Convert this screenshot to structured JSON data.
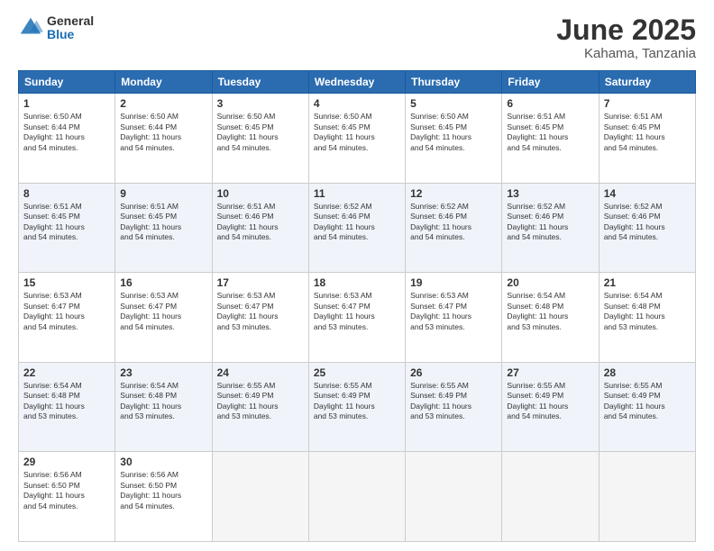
{
  "logo": {
    "general": "General",
    "blue": "Blue"
  },
  "header": {
    "month": "June 2025",
    "location": "Kahama, Tanzania"
  },
  "days_of_week": [
    "Sunday",
    "Monday",
    "Tuesday",
    "Wednesday",
    "Thursday",
    "Friday",
    "Saturday"
  ],
  "weeks": [
    {
      "cells": [
        {
          "day": "1",
          "sunrise": "6:50 AM",
          "sunset": "6:44 PM",
          "daylight": "11 hours and 54 minutes."
        },
        {
          "day": "2",
          "sunrise": "6:50 AM",
          "sunset": "6:44 PM",
          "daylight": "11 hours and 54 minutes."
        },
        {
          "day": "3",
          "sunrise": "6:50 AM",
          "sunset": "6:45 PM",
          "daylight": "11 hours and 54 minutes."
        },
        {
          "day": "4",
          "sunrise": "6:50 AM",
          "sunset": "6:45 PM",
          "daylight": "11 hours and 54 minutes."
        },
        {
          "day": "5",
          "sunrise": "6:50 AM",
          "sunset": "6:45 PM",
          "daylight": "11 hours and 54 minutes."
        },
        {
          "day": "6",
          "sunrise": "6:51 AM",
          "sunset": "6:45 PM",
          "daylight": "11 hours and 54 minutes."
        },
        {
          "day": "7",
          "sunrise": "6:51 AM",
          "sunset": "6:45 PM",
          "daylight": "11 hours and 54 minutes."
        }
      ]
    },
    {
      "cells": [
        {
          "day": "8",
          "sunrise": "6:51 AM",
          "sunset": "6:45 PM",
          "daylight": "11 hours and 54 minutes."
        },
        {
          "day": "9",
          "sunrise": "6:51 AM",
          "sunset": "6:45 PM",
          "daylight": "11 hours and 54 minutes."
        },
        {
          "day": "10",
          "sunrise": "6:51 AM",
          "sunset": "6:46 PM",
          "daylight": "11 hours and 54 minutes."
        },
        {
          "day": "11",
          "sunrise": "6:52 AM",
          "sunset": "6:46 PM",
          "daylight": "11 hours and 54 minutes."
        },
        {
          "day": "12",
          "sunrise": "6:52 AM",
          "sunset": "6:46 PM",
          "daylight": "11 hours and 54 minutes."
        },
        {
          "day": "13",
          "sunrise": "6:52 AM",
          "sunset": "6:46 PM",
          "daylight": "11 hours and 54 minutes."
        },
        {
          "day": "14",
          "sunrise": "6:52 AM",
          "sunset": "6:46 PM",
          "daylight": "11 hours and 54 minutes."
        }
      ]
    },
    {
      "cells": [
        {
          "day": "15",
          "sunrise": "6:53 AM",
          "sunset": "6:47 PM",
          "daylight": "11 hours and 54 minutes."
        },
        {
          "day": "16",
          "sunrise": "6:53 AM",
          "sunset": "6:47 PM",
          "daylight": "11 hours and 54 minutes."
        },
        {
          "day": "17",
          "sunrise": "6:53 AM",
          "sunset": "6:47 PM",
          "daylight": "11 hours and 53 minutes."
        },
        {
          "day": "18",
          "sunrise": "6:53 AM",
          "sunset": "6:47 PM",
          "daylight": "11 hours and 53 minutes."
        },
        {
          "day": "19",
          "sunrise": "6:53 AM",
          "sunset": "6:47 PM",
          "daylight": "11 hours and 53 minutes."
        },
        {
          "day": "20",
          "sunrise": "6:54 AM",
          "sunset": "6:48 PM",
          "daylight": "11 hours and 53 minutes."
        },
        {
          "day": "21",
          "sunrise": "6:54 AM",
          "sunset": "6:48 PM",
          "daylight": "11 hours and 53 minutes."
        }
      ]
    },
    {
      "cells": [
        {
          "day": "22",
          "sunrise": "6:54 AM",
          "sunset": "6:48 PM",
          "daylight": "11 hours and 53 minutes."
        },
        {
          "day": "23",
          "sunrise": "6:54 AM",
          "sunset": "6:48 PM",
          "daylight": "11 hours and 53 minutes."
        },
        {
          "day": "24",
          "sunrise": "6:55 AM",
          "sunset": "6:49 PM",
          "daylight": "11 hours and 53 minutes."
        },
        {
          "day": "25",
          "sunrise": "6:55 AM",
          "sunset": "6:49 PM",
          "daylight": "11 hours and 53 minutes."
        },
        {
          "day": "26",
          "sunrise": "6:55 AM",
          "sunset": "6:49 PM",
          "daylight": "11 hours and 53 minutes."
        },
        {
          "day": "27",
          "sunrise": "6:55 AM",
          "sunset": "6:49 PM",
          "daylight": "11 hours and 54 minutes."
        },
        {
          "day": "28",
          "sunrise": "6:55 AM",
          "sunset": "6:49 PM",
          "daylight": "11 hours and 54 minutes."
        }
      ]
    },
    {
      "cells": [
        {
          "day": "29",
          "sunrise": "6:56 AM",
          "sunset": "6:50 PM",
          "daylight": "11 hours and 54 minutes."
        },
        {
          "day": "30",
          "sunrise": "6:56 AM",
          "sunset": "6:50 PM",
          "daylight": "11 hours and 54 minutes."
        },
        null,
        null,
        null,
        null,
        null
      ]
    }
  ],
  "labels": {
    "sunrise": "Sunrise:",
    "sunset": "Sunset:",
    "daylight": "Daylight:"
  }
}
